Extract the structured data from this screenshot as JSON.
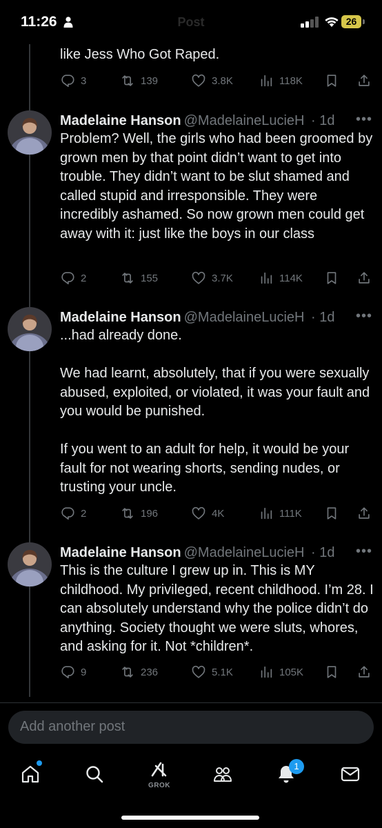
{
  "status_bar": {
    "time": "11:26",
    "battery_level": "26",
    "faded_title": "Post",
    "battery_color": "#d6c64a"
  },
  "thread": {
    "top_fragment": {
      "text": "like Jess Who Got Raped.",
      "replies": "3",
      "reposts": "139",
      "likes": "3.8K",
      "views": "118K"
    },
    "posts": [
      {
        "author": "Madelaine Hanson",
        "handle": "@MadelaineLucieH",
        "time": "· 1d",
        "text": "Problem? Well, the girls who had been groomed by grown men by that point didn’t want to get into trouble. They didn’t want to be slut shamed and called stupid and irresponsible. They were incredibly ashamed. So now grown men could get away with it: just like the boys in our class",
        "replies": "2",
        "reposts": "155",
        "likes": "3.7K",
        "views": "114K"
      },
      {
        "author": "Madelaine Hanson",
        "handle": "@MadelaineLucieH",
        "time": "· 1d",
        "text": "...had already done.\n\nWe had learnt, absolutely, that if you were sexually abused, exploited, or violated, it was your fault and you would be punished.\n\nIf you went to an adult for help, it would be your fault for not wearing shorts, sending nudes, or trusting your uncle.",
        "replies": "2",
        "reposts": "196",
        "likes": "4K",
        "views": "111K"
      },
      {
        "author": "Madelaine Hanson",
        "handle": "@MadelaineLucieH",
        "time": "· 1d",
        "text": "This is the culture I grew up in. This is MY childhood. My privileged, recent childhood. I’m 28. I can absolutely understand why the police didn’t do anything. Society thought we were sluts, whores, and asking for it. Not *children*.",
        "replies": "9",
        "reposts": "236",
        "likes": "5.1K",
        "views": "105K"
      }
    ]
  },
  "composer": {
    "placeholder": "Add another post"
  },
  "tab_bar": {
    "grok_label": "GROK",
    "notifications_count": "1",
    "accent_color": "#1d9bf0"
  },
  "icons": {
    "reply": "reply-icon",
    "repost": "repost-icon",
    "like": "like-icon",
    "views": "views-icon",
    "bookmark": "bookmark-icon",
    "share": "share-icon",
    "more": "more-icon"
  }
}
